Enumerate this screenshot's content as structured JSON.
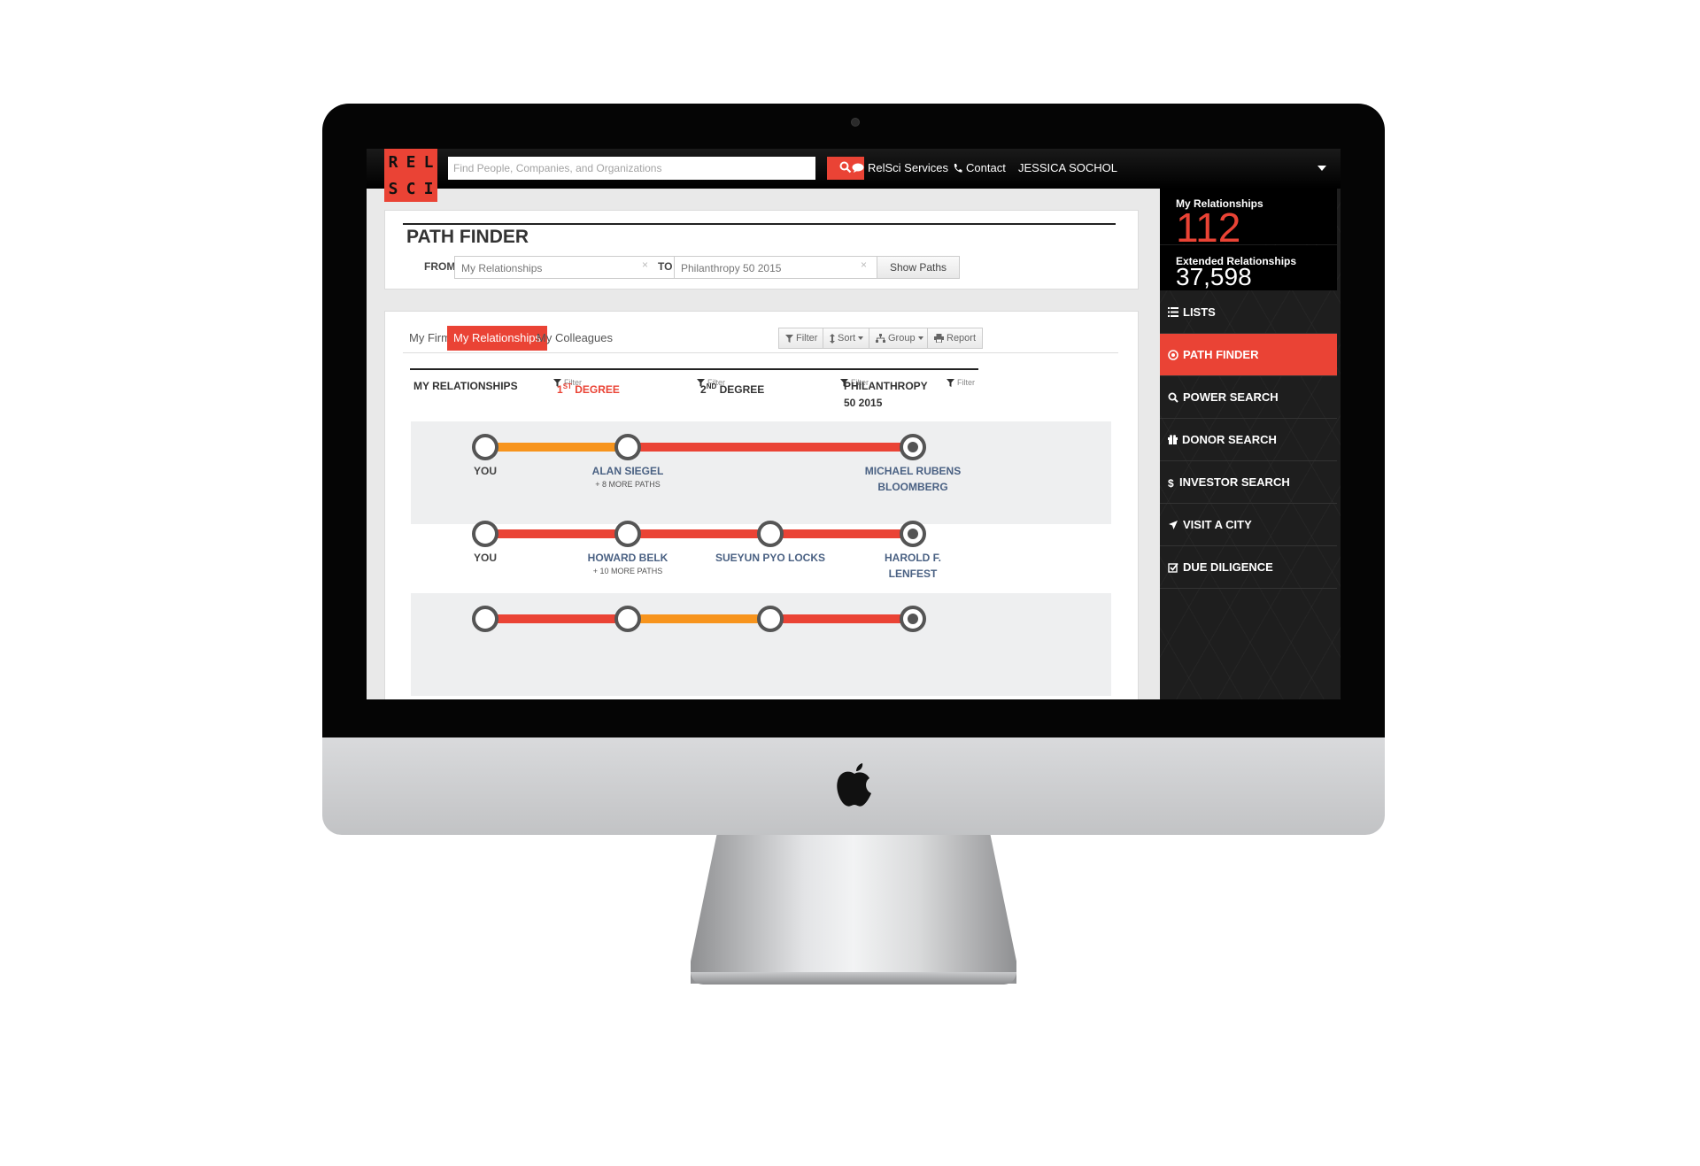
{
  "topbar": {
    "logo_letters": [
      "R",
      "E",
      "L",
      "S",
      "C",
      "I"
    ],
    "search_placeholder": "Find People, Companies, and Organizations",
    "services_label": "RelSci Services",
    "contact_label": "Contact",
    "user_name": "JESSICA SOCHOL"
  },
  "path_finder": {
    "title": "PATH FINDER",
    "from_label": "FROM",
    "from_value": "My Relationships",
    "to_label": "TO",
    "to_value": "Philanthropy 50 2015",
    "clear_glyph": "×",
    "show_paths_label": "Show Paths"
  },
  "results": {
    "tabs": [
      "My Firm",
      "My Relationships",
      "My Colleagues"
    ],
    "active_tab": "My Relationships",
    "tools": {
      "filter": "Filter",
      "sort": "Sort",
      "group": "Group",
      "report": "Report"
    },
    "columns": [
      {
        "title": "MY RELATIONSHIPS",
        "filter": "Filter"
      },
      {
        "title_num": "1",
        "title_sup": "ST",
        "title_rest": " DEGREE",
        "filter": "Filter"
      },
      {
        "title_num": "2",
        "title_sup": "ND",
        "title_rest": " DEGREE",
        "filter": "Filter"
      },
      {
        "title": "PHILANTHROPY 50 2015",
        "filter": "Filter"
      }
    ],
    "paths": [
      {
        "labels": [
          "YOU",
          "ALAN SIEGEL",
          "",
          "MICHAEL RUBENS BLOOMBERG"
        ],
        "more": "+ 8 MORE PATHS",
        "segments": [
          "orange",
          "red",
          "red"
        ]
      },
      {
        "labels": [
          "YOU",
          "HOWARD BELK",
          "SUEYUN PYO LOCKS",
          "HAROLD F. LENFEST"
        ],
        "more": "+ 10 MORE PATHS",
        "segments": [
          "red",
          "red",
          "red"
        ]
      },
      {
        "labels": [
          "",
          "",
          "",
          ""
        ],
        "more": "",
        "segments": [
          "red",
          "orange",
          "red"
        ]
      }
    ]
  },
  "sidebar": {
    "my_relationships_label": "My Relationships",
    "my_relationships_count": "112",
    "extended_label": "Extended Relationships",
    "extended_count": "37,598",
    "items": [
      {
        "label": "LISTS",
        "icon": "list-icon"
      },
      {
        "label": "PATH FINDER",
        "icon": "target-icon"
      },
      {
        "label": "POWER SEARCH",
        "icon": "search-icon"
      },
      {
        "label": "DONOR SEARCH",
        "icon": "gift-icon"
      },
      {
        "label": "INVESTOR SEARCH",
        "icon": "dollar-icon"
      },
      {
        "label": "VISIT A CITY",
        "icon": "plane-icon"
      },
      {
        "label": "DUE DILIGENCE",
        "icon": "checkbox-icon"
      }
    ],
    "active_item": "PATH FINDER"
  },
  "colors": {
    "accent": "#ea4335",
    "orange": "#f7941d",
    "node": "#555555",
    "link_label": "#4a6183"
  }
}
